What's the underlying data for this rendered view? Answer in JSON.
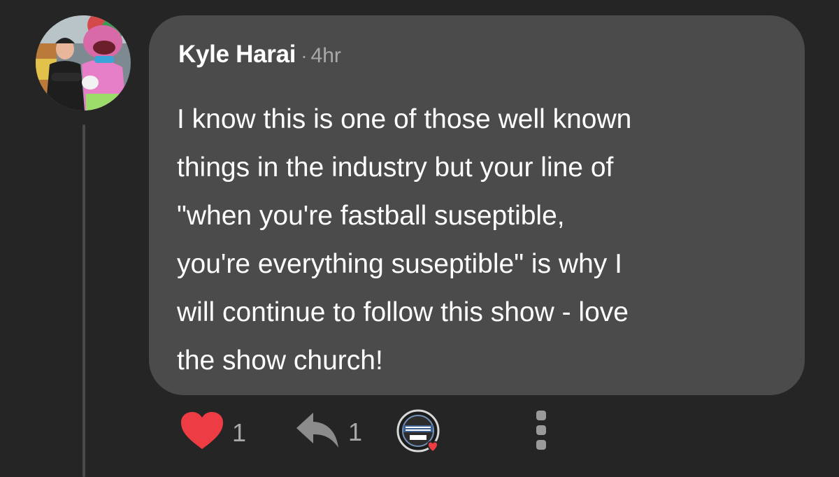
{
  "comment": {
    "author": "Kyle Harai",
    "separator": "·",
    "timestamp": "4hr",
    "body_lines": [
      "I know this is one of those well known",
      "things in the industry but your line of",
      "\"when you're fastball suseptible,",
      "you're everything suseptible\" is why I",
      "will continue to follow this show - love",
      "the show church!"
    ]
  },
  "actions": {
    "like_count": "1",
    "reply_count": "1",
    "like_icon": "heart-icon",
    "reply_icon": "reply-arrow-icon",
    "more_icon": "more-vertical-icon"
  },
  "colors": {
    "background": "#252525",
    "bubble": "#4b4b4b",
    "like": "#ee3c45",
    "muted": "#a9a9a9"
  }
}
